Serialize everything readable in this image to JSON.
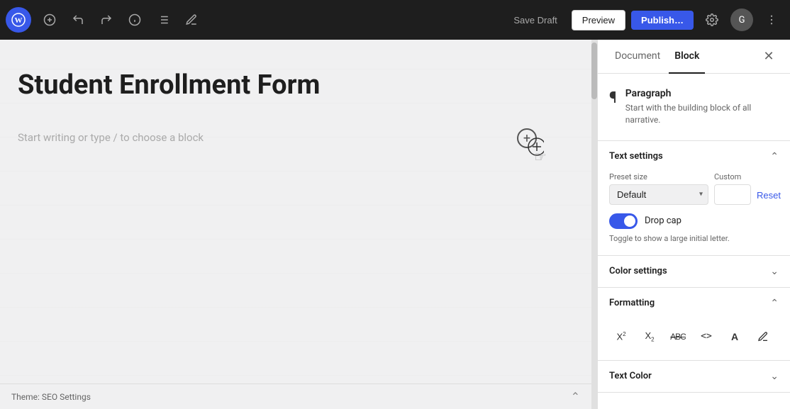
{
  "toolbar": {
    "wp_logo": "W",
    "save_draft_label": "Save Draft",
    "preview_label": "Preview",
    "publish_label": "Publish…",
    "user_avatar": "G",
    "add_block_tooltip": "Add block",
    "undo_tooltip": "Undo",
    "redo_tooltip": "Redo",
    "info_tooltip": "Block information",
    "list_view_tooltip": "List view",
    "tools_tooltip": "Tools"
  },
  "editor": {
    "title": "Student Enrollment Form",
    "paragraph_placeholder": "Start writing or type / to choose a block",
    "bottom_bar_label": "Theme: SEO Settings"
  },
  "sidebar": {
    "tab_document": "Document",
    "tab_block": "Block",
    "block_info": {
      "title": "Paragraph",
      "description": "Start with the building block of all narrative."
    },
    "text_settings": {
      "section_title": "Text settings",
      "preset_size_label": "Preset size",
      "custom_label": "Custom",
      "preset_default": "Default",
      "reset_label": "Reset"
    },
    "drop_cap": {
      "label": "Drop cap",
      "hint": "Toggle to show a large initial letter.",
      "enabled": true
    },
    "color_settings": {
      "section_title": "Color settings"
    },
    "formatting": {
      "section_title": "Formatting",
      "buttons": [
        "X²",
        "X₂",
        "ABC̶",
        "<>",
        "A",
        "🖊"
      ]
    },
    "text_color": {
      "section_title": "Text Color"
    }
  }
}
